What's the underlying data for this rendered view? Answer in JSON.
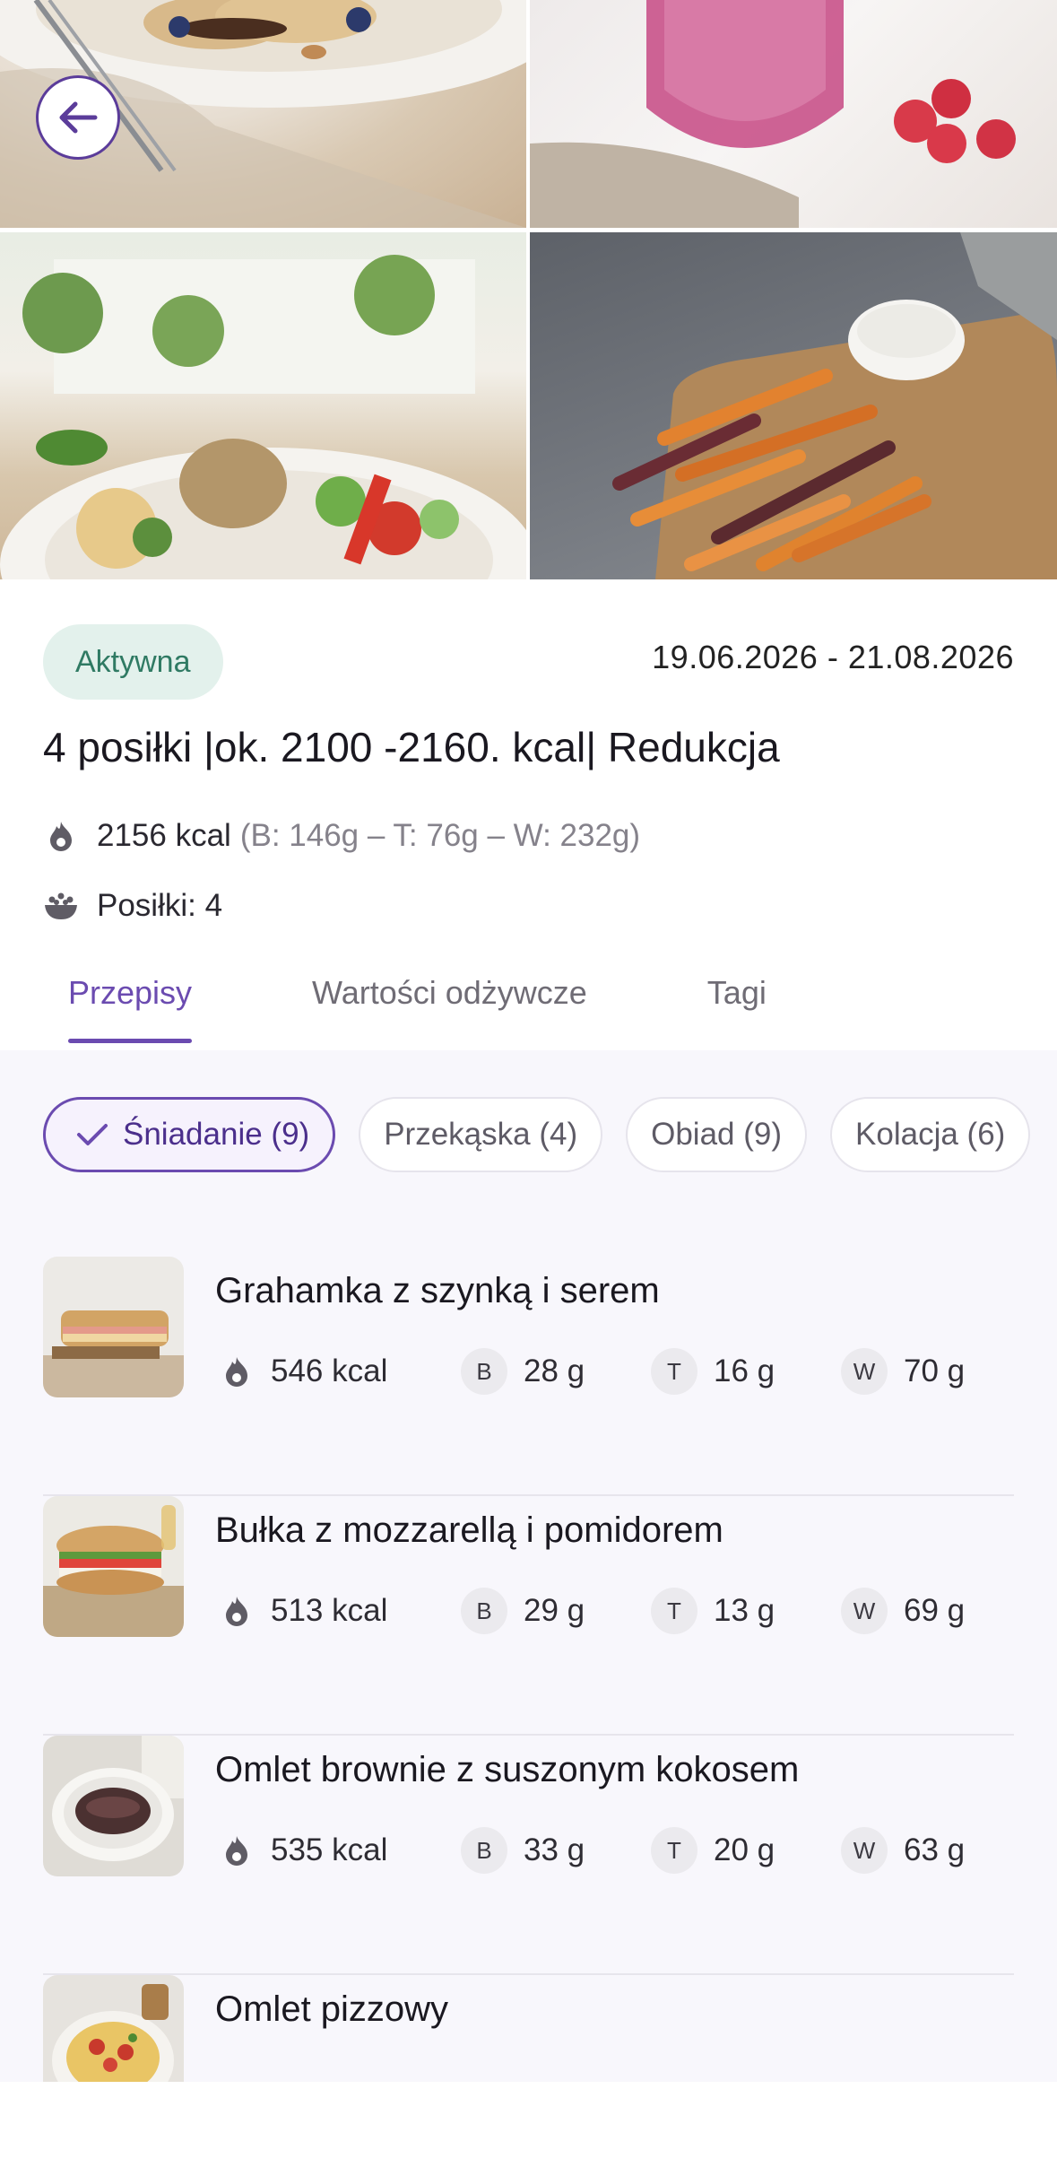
{
  "hero": {
    "back_icon": "arrow-left-icon",
    "colors": {
      "accent": "#5b3c9a"
    }
  },
  "plan": {
    "status": "Aktywna",
    "dates": "19.06.2026 - 21.08.2026",
    "title": "4 posiłki |ok. 2100 -2160. kcal| Redukcja",
    "kcal": "2156 kcal",
    "macros": "(B: 146g – T: 76g – W: 232g)",
    "meals": "Posiłki: 4"
  },
  "tabs": [
    {
      "label": "Przepisy",
      "active": true
    },
    {
      "label": "Wartości odżywcze",
      "active": false
    },
    {
      "label": "Tagi",
      "active": false
    }
  ],
  "filters": [
    {
      "label": "Śniadanie (9)",
      "active": true
    },
    {
      "label": "Przekąska (4)",
      "active": false
    },
    {
      "label": "Obiad (9)",
      "active": false
    },
    {
      "label": "Kolacja (6)",
      "active": false
    }
  ],
  "recipes": [
    {
      "name": "Grahamka z szynką i  serem",
      "kcal": "546 kcal",
      "b": "28 g",
      "t": "16 g",
      "w": "70 g"
    },
    {
      "name": "Bułka z mozzarellą i pomidorem",
      "kcal": "513 kcal",
      "b": "29 g",
      "t": "13 g",
      "w": "69 g"
    },
    {
      "name": "Omlet brownie z suszonym kokosem",
      "kcal": "535 kcal",
      "b": "33 g",
      "t": "20 g",
      "w": "63 g"
    },
    {
      "name": "Omlet pizzowy"
    }
  ],
  "macro_keys": {
    "b": "B",
    "t": "T",
    "w": "W"
  }
}
